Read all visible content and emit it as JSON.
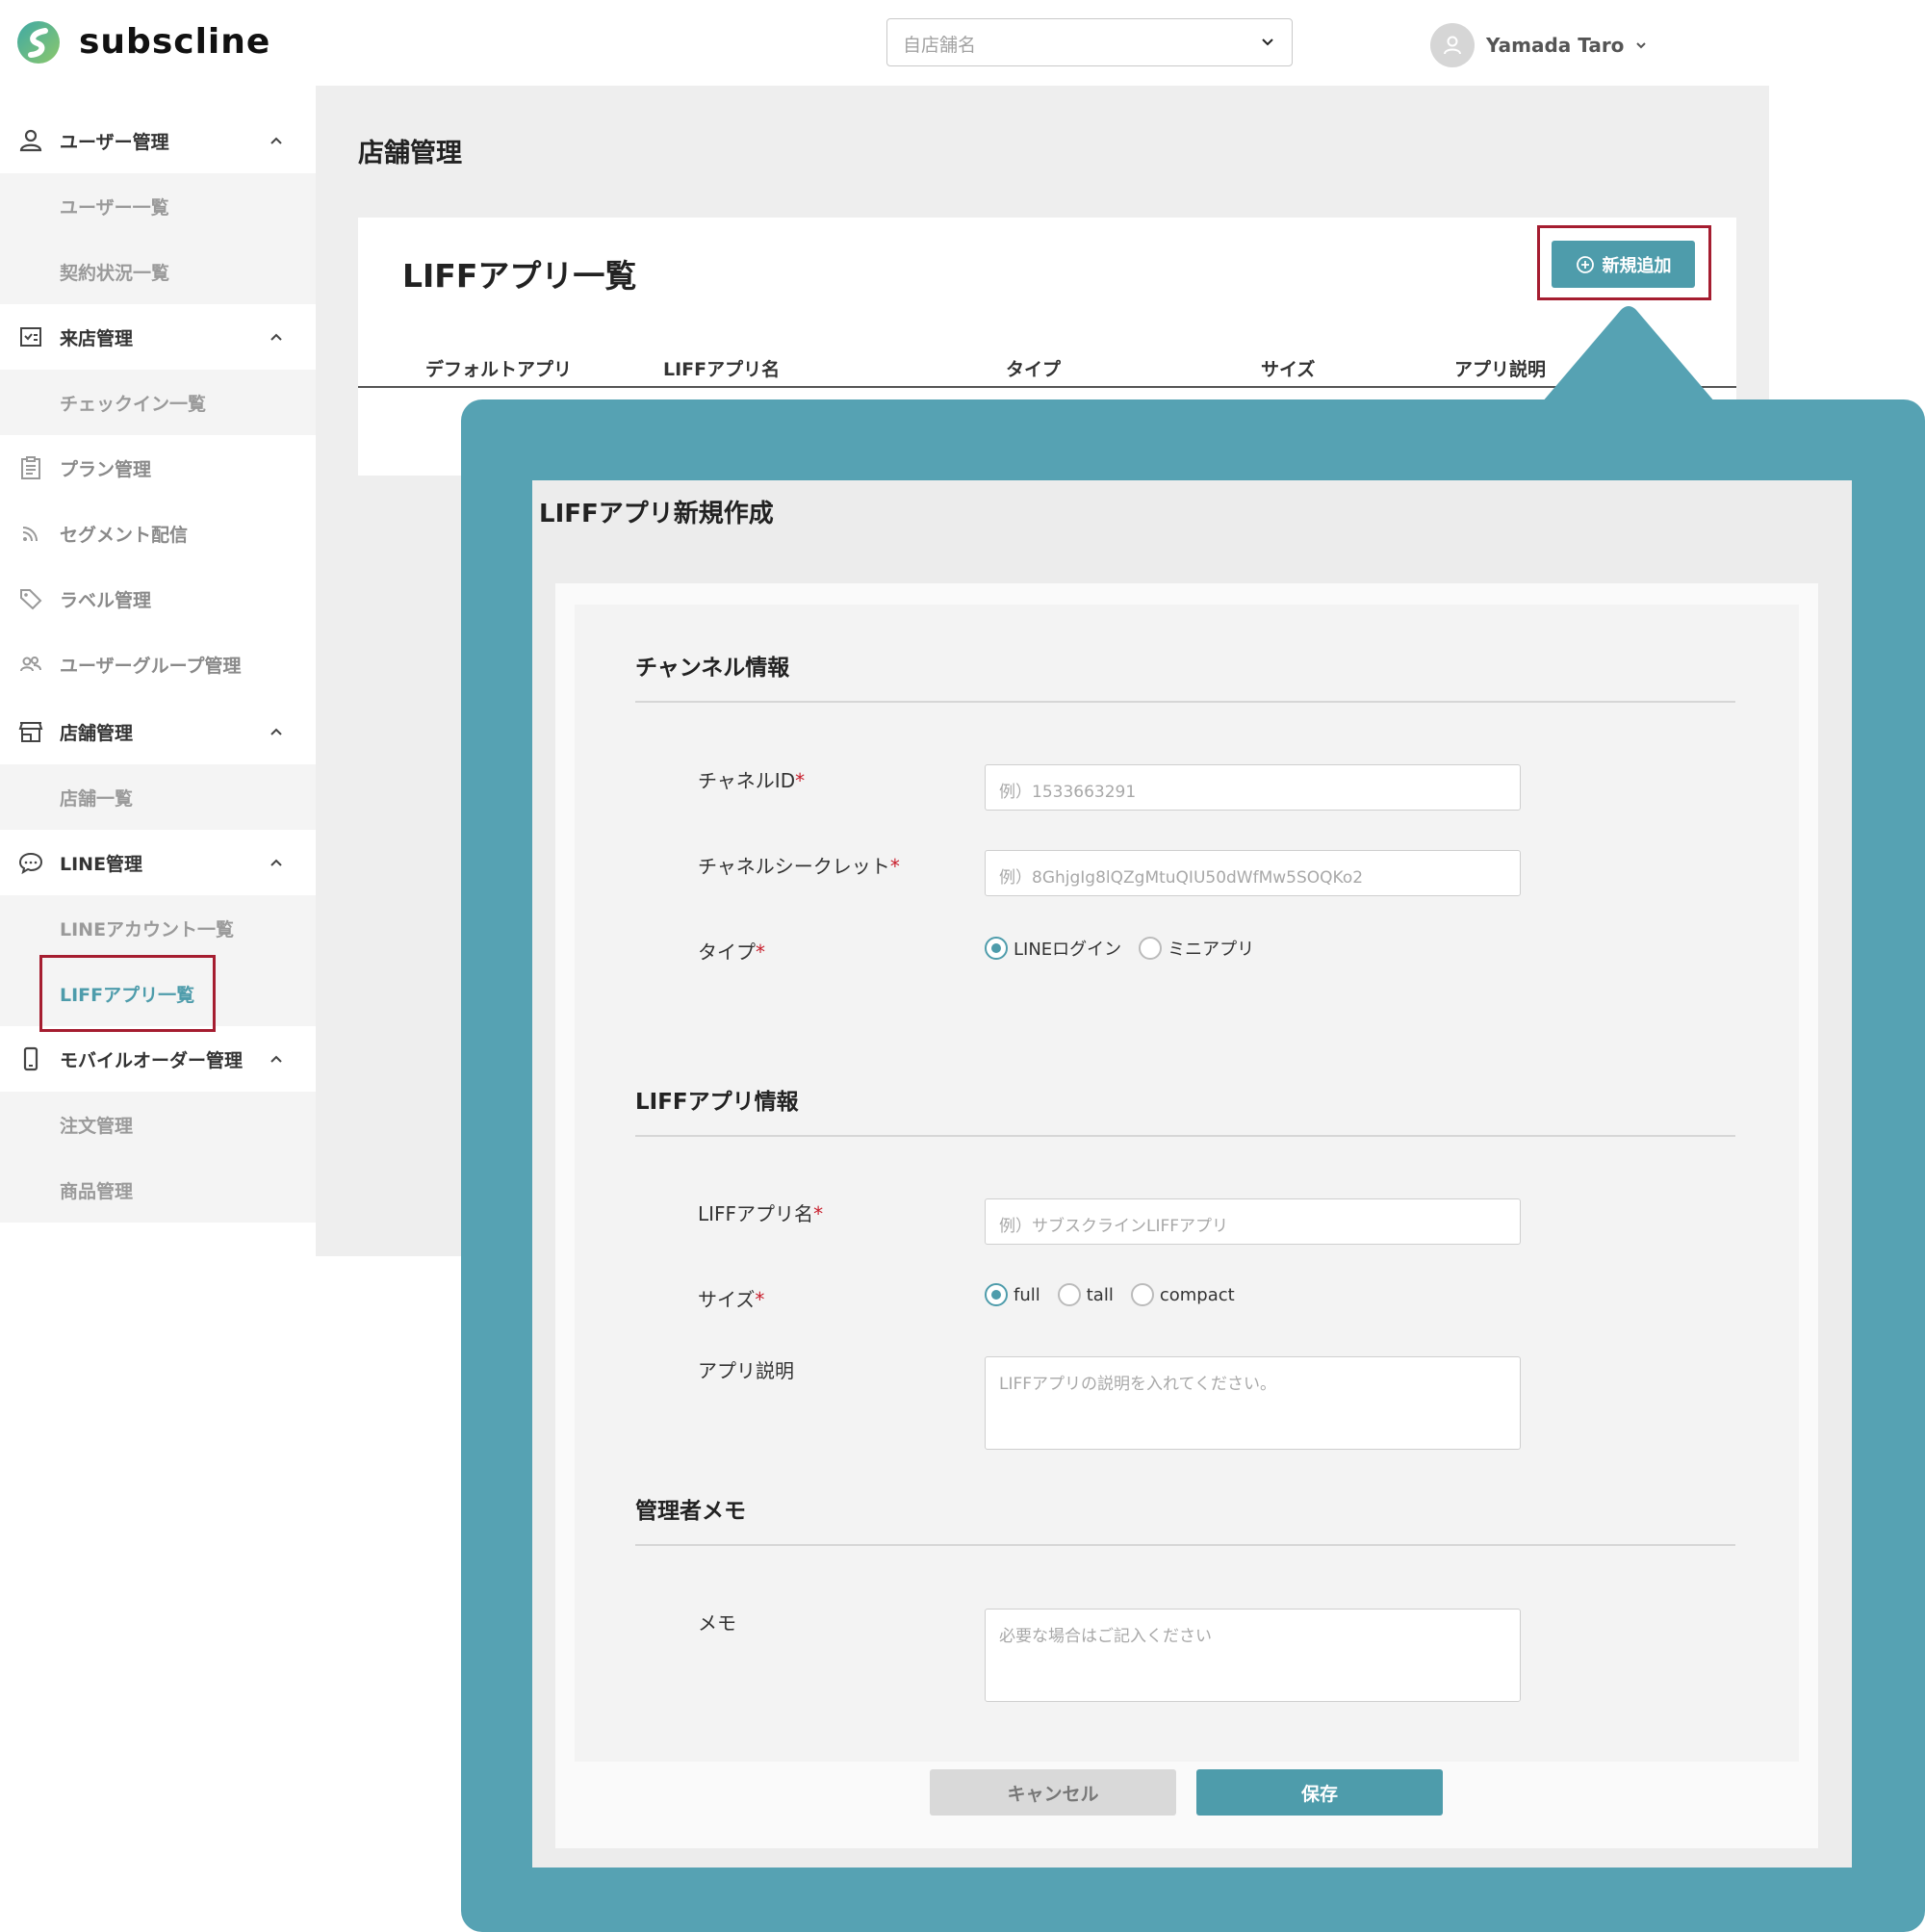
{
  "brand": {
    "name": "subscline",
    "accent": "#4e9cab",
    "highlight": "#a51d30",
    "callout": "#56a2b3"
  },
  "header": {
    "store_select_placeholder": "自店舗名",
    "user_name": "Yamada Taro"
  },
  "sidebar": {
    "groups": [
      {
        "label": "ユーザー管理",
        "icon": "user-icon",
        "children": [
          "ユーザー一覧",
          "契約状況一覧"
        ]
      },
      {
        "label": "来店管理",
        "icon": "checkin-icon",
        "children": [
          "チェックイン一覧"
        ]
      },
      {
        "label": "プラン管理",
        "icon": "clipboard-icon"
      },
      {
        "label": "セグメント配信",
        "icon": "rss-icon"
      },
      {
        "label": "ラベル管理",
        "icon": "tag-icon"
      },
      {
        "label": "ユーザーグループ管理",
        "icon": "group-icon"
      },
      {
        "label": "店舗管理",
        "icon": "store-icon",
        "children": [
          "店舗一覧"
        ]
      },
      {
        "label": "LINE管理",
        "icon": "chat-icon",
        "children": [
          "LINEアカウント一覧",
          "LIFFアプリ一覧"
        ]
      },
      {
        "label": "モバイルオーダー管理",
        "icon": "mobile-icon",
        "children": [
          "注文管理",
          "商品管理"
        ]
      }
    ],
    "active_item": "LIFFアプリ一覧"
  },
  "main": {
    "page_title": "店舗管理",
    "card_title": "LIFFアプリ一覧",
    "add_button": "新規追加",
    "columns": [
      "デフォルトアプリ",
      "LIFFアプリ名",
      "タイプ",
      "サイズ",
      "アプリ説明"
    ]
  },
  "modal": {
    "title": "LIFFアプリ新規作成",
    "sections": {
      "channel": "チャンネル情報",
      "liff": "LIFFアプリ情報",
      "memo": "管理者メモ"
    },
    "fields": {
      "channel_id": {
        "label": "チャネルID",
        "placeholder": "例）1533663291"
      },
      "channel_secret": {
        "label": "チャネルシークレット",
        "placeholder": "例）8GhjgIg8lQZgMtuQIU50dWfMw5SOQKo2"
      },
      "type": {
        "label": "タイプ",
        "options": [
          "LINEログイン",
          "ミニアプリ"
        ],
        "selected": "LINEログイン"
      },
      "liff_name": {
        "label": "LIFFアプリ名",
        "placeholder": "例）サブスクラインLIFFアプリ"
      },
      "size": {
        "label": "サイズ",
        "options": [
          "full",
          "tall",
          "compact"
        ],
        "selected": "full"
      },
      "description": {
        "label": "アプリ説明",
        "placeholder": "LIFFアプリの説明を入れてください。"
      },
      "memo": {
        "label": "メモ",
        "placeholder": "必要な場合はご記入ください"
      }
    },
    "required_mark": "*",
    "cancel_button": "キャンセル",
    "save_button": "保存"
  }
}
